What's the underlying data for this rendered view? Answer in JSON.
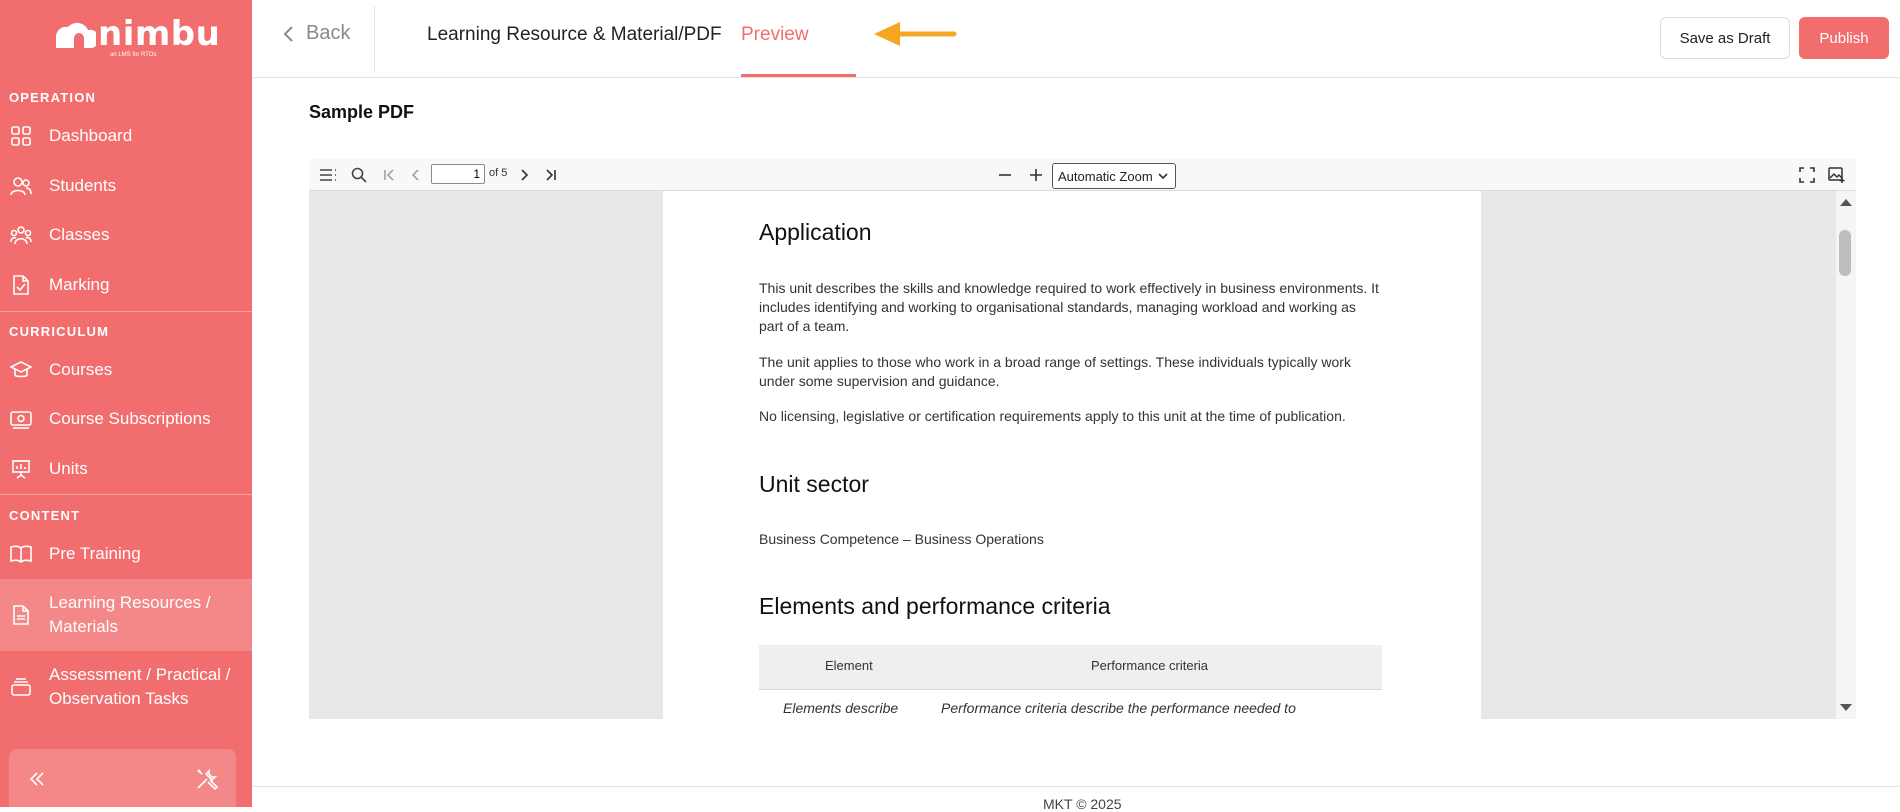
{
  "brand": {
    "name": "nimbu",
    "tagline": "an LMS for RTOs"
  },
  "sidebar": {
    "sections": [
      {
        "label": "OPERATION"
      },
      {
        "label": "CURRICULUM"
      },
      {
        "label": "CONTENT"
      }
    ],
    "items": [
      {
        "label": "Dashboard",
        "icon": "dashboard-icon"
      },
      {
        "label": "Students",
        "icon": "users-icon"
      },
      {
        "label": "Classes",
        "icon": "group-icon"
      },
      {
        "label": "Marking",
        "icon": "file-check-icon"
      },
      {
        "label": "Courses",
        "icon": "graduation-cap-icon"
      },
      {
        "label": "Course Subscriptions",
        "icon": "subscription-icon"
      },
      {
        "label": "Units",
        "icon": "presentation-icon"
      },
      {
        "label": "Pre Training",
        "icon": "book-open-icon"
      },
      {
        "label": "Learning Resources / Materials",
        "line1": "Learning Resources /",
        "line2": "Materials",
        "icon": "document-icon",
        "active": true
      },
      {
        "label": "Assessment / Practical / Observation Tasks",
        "line1": "Assessment / Practical /",
        "line2": "Observation Tasks",
        "icon": "stack-icon"
      }
    ]
  },
  "header": {
    "back_label": "Back",
    "breadcrumb": "Learning Resource & Material/PDF",
    "active_tab": "Preview",
    "save_draft_label": "Save as Draft",
    "publish_label": "Publish"
  },
  "content": {
    "title": "Sample PDF"
  },
  "pdf_viewer": {
    "page_current": "1",
    "page_total_text": "of 5",
    "zoom": "Automatic Zoom",
    "page": {
      "heading_application": "Application",
      "para1": "This unit describes the skills and knowledge required to work effectively in business environments. It includes identifying and working to organisational standards, managing workload and working as part of a team.",
      "para2": "The unit applies to those who work in a broad range of settings. These individuals typically work under some supervision and guidance.",
      "para3": "No licensing, legislative or certification requirements apply to this unit at the time of publication.",
      "heading_sector": "Unit sector",
      "sector_text": "Business Competence – Business Operations",
      "heading_elements": "Elements and performance criteria",
      "table_headers": [
        "Element",
        "Performance criteria"
      ],
      "table_row": [
        "Elements describe",
        "Performance criteria describe the performance needed to"
      ]
    }
  },
  "footer": {
    "text": "MKT © 2025"
  },
  "colors": {
    "brand": "#f26d6d",
    "arrow": "#f5a623"
  }
}
